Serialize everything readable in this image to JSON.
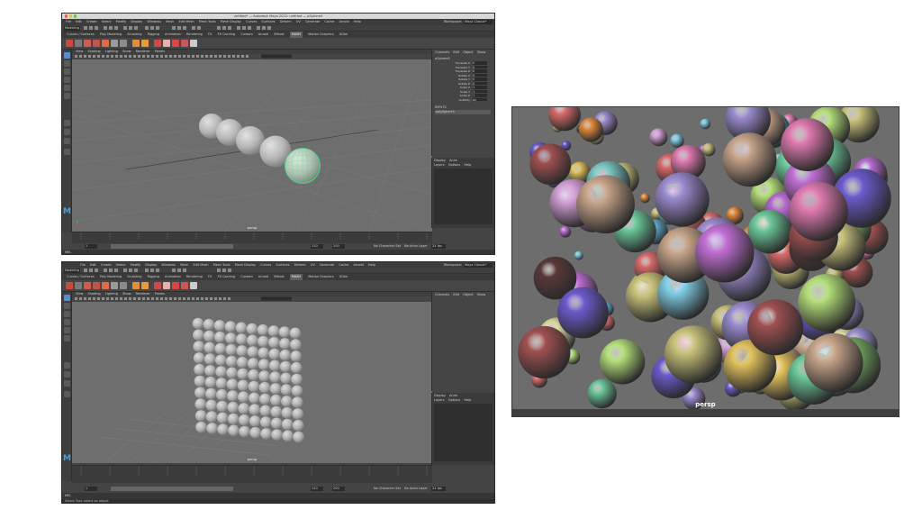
{
  "window_title": "untitled* — Autodesk Maya 2022: untitled   —   pSphere5",
  "menus": [
    "File",
    "Edit",
    "Create",
    "Select",
    "Modify",
    "Display",
    "Windows",
    "Mesh",
    "Edit Mesh",
    "Mesh Tools",
    "Mesh Display",
    "Curves",
    "Surfaces",
    "Deform",
    "UV",
    "Generate",
    "Cache",
    "Arnold",
    "Help"
  ],
  "workspace": {
    "label": "Workspace:",
    "value": "Maya Classic*"
  },
  "mode_dropdown": "Modeling",
  "shelf_tabs": [
    "Curves / Surfaces",
    "Poly Modeling",
    "Sculpting",
    "Rigging",
    "Animation",
    "Rendering",
    "FX",
    "FX Caching",
    "Custom",
    "Arnold",
    "Bifrost",
    "MASH",
    "Motion Graphics",
    "XGen"
  ],
  "active_shelf_tab": "MASH",
  "panel_menus": [
    "View",
    "Shading",
    "Lighting",
    "Show",
    "Renderer",
    "Panels"
  ],
  "camera_label": "persp",
  "channel_box": {
    "tabs": [
      "Channels",
      "Edit",
      "Object",
      "Show"
    ],
    "object_name": "pSphere5",
    "attributes": [
      "Translate X",
      "Translate Y",
      "Translate Z",
      "Rotate X",
      "Rotate Y",
      "Rotate Z",
      "Scale X",
      "Scale Y",
      "Scale Z",
      "Visibility"
    ],
    "values": [
      "0",
      "0",
      "0",
      "0",
      "0",
      "0",
      "1",
      "1",
      "1",
      "on"
    ],
    "inputs_header": "INPUTS",
    "inputs": [
      "polySphere5"
    ]
  },
  "layers": {
    "tabs": [
      "Display",
      "Anim"
    ],
    "menus": [
      "Layers",
      "Options",
      "Help"
    ]
  },
  "range": {
    "start": "1",
    "end": "120",
    "playback_end": "200"
  },
  "no_character_set": "No Character Set",
  "no_anim_layer": "No Anim Layer",
  "fps": "24 fps",
  "cmd_label": "MEL",
  "help_line": "Select Tool: select an object",
  "render_view": {
    "camera_label": "persp"
  }
}
